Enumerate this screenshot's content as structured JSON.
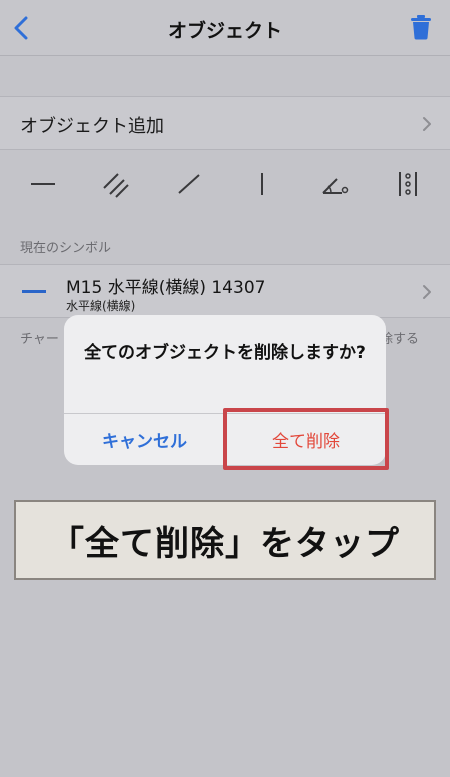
{
  "nav": {
    "title": "オブジェクト",
    "back_icon": "chevron-left-icon",
    "trash_icon": "trash-icon"
  },
  "add_object": {
    "label": "オブジェクト追加"
  },
  "tools": [
    {
      "icon": "horizontal-line-icon"
    },
    {
      "icon": "parallel-lines-icon"
    },
    {
      "icon": "trend-line-icon"
    },
    {
      "icon": "vertical-line-icon"
    },
    {
      "icon": "angle-icon"
    },
    {
      "icon": "fibonacci-icon"
    }
  ],
  "current_symbol": {
    "section_label": "現在のシンボル",
    "title": "M15 水平線(横線) 14307",
    "subtitle": "水平線(横線)"
  },
  "note": {
    "left": "チャー",
    "right": "除する"
  },
  "alert": {
    "message": "全てのオブジェクトを削除しますか?",
    "cancel_label": "キャンセル",
    "delete_label": "全て削除"
  },
  "caption": {
    "text": "「全て削除」をタップ"
  },
  "colors": {
    "accent_blue": "#2f6fd8",
    "destructive_red": "#e2473a",
    "highlight_red": "#c9454a"
  }
}
